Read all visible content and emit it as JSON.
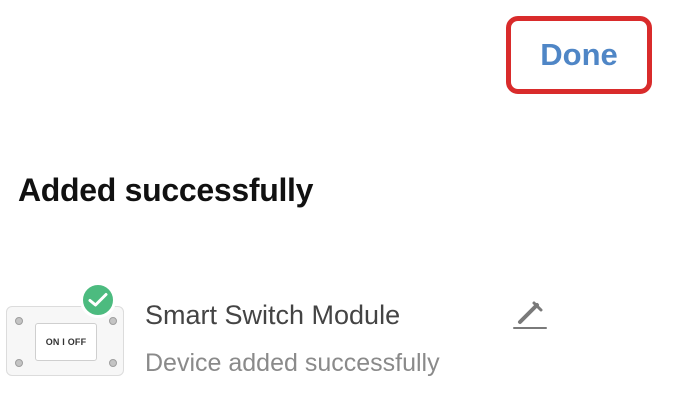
{
  "header": {
    "done_label": "Done"
  },
  "main": {
    "title": "Added successfully",
    "device": {
      "name": "Smart Switch Module",
      "status": "Device added successfully",
      "switch_text": "ON I OFF"
    }
  },
  "colors": {
    "accent": "#4f86c6",
    "highlight": "#d92b2b",
    "success": "#4cbb7f"
  },
  "icons": {
    "done_highlight": "highlight-frame",
    "badge": "check-icon",
    "edit": "pencil-icon"
  }
}
